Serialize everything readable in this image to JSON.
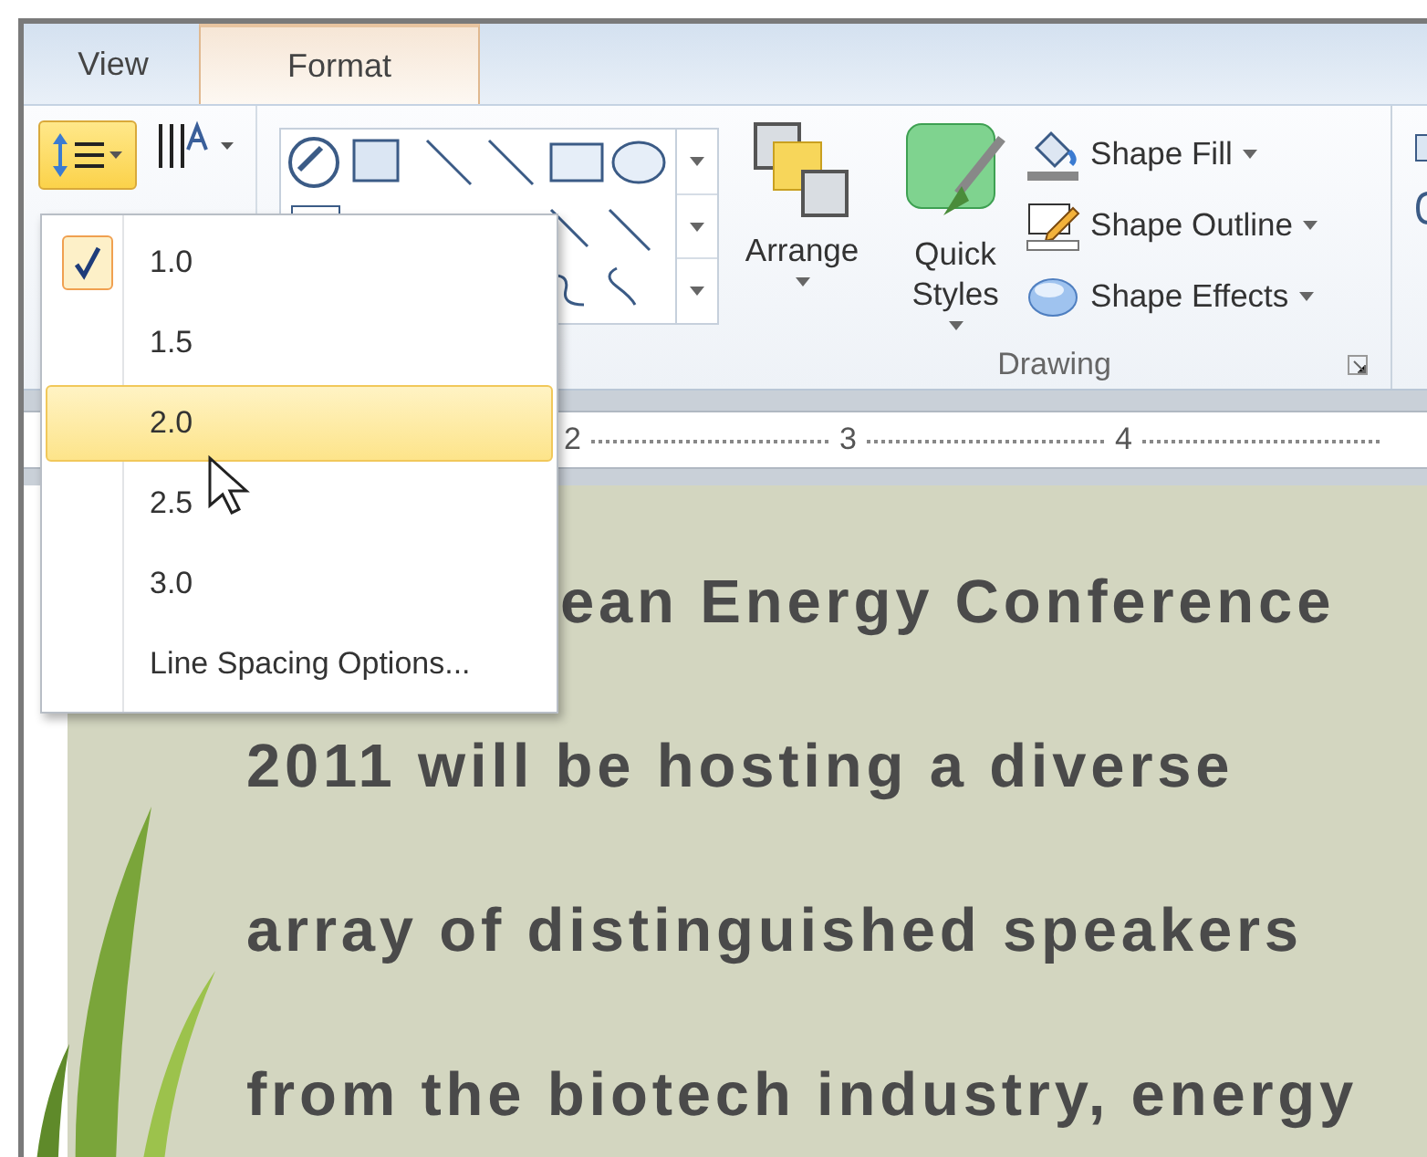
{
  "tabs": [
    {
      "label": "View",
      "selected": false
    },
    {
      "label": "Format",
      "selected": true
    }
  ],
  "ribbon": {
    "line_spacing_button": {
      "open": true
    },
    "drawing_group": {
      "label": "Drawing",
      "large_buttons": [
        {
          "label": "Arrange",
          "kind": "arrange"
        },
        {
          "label": "Quick Styles",
          "kind": "styles"
        }
      ],
      "shape_commands": [
        {
          "label": "Shape Fill",
          "kind": "fill"
        },
        {
          "label": "Shape Outline",
          "kind": "outline"
        },
        {
          "label": "Shape Effects",
          "kind": "effects"
        }
      ]
    }
  },
  "ruler": {
    "labels": [
      "2",
      "3",
      "4"
    ]
  },
  "line_spacing_menu": {
    "items": [
      {
        "label": "1.0",
        "checked": true,
        "highlighted": false
      },
      {
        "label": "1.5",
        "checked": false,
        "highlighted": false
      },
      {
        "label": "2.0",
        "checked": false,
        "highlighted": true
      },
      {
        "label": "2.5",
        "checked": false,
        "highlighted": false
      },
      {
        "label": "3.0",
        "checked": false,
        "highlighted": false
      }
    ],
    "options_label": "Line Spacing Options..."
  },
  "document": {
    "lines": [
      "ean Energy Conference",
      "2011 will be hosting a diverse",
      "array of distinguished speakers",
      "from the biotech industry, energy"
    ]
  }
}
